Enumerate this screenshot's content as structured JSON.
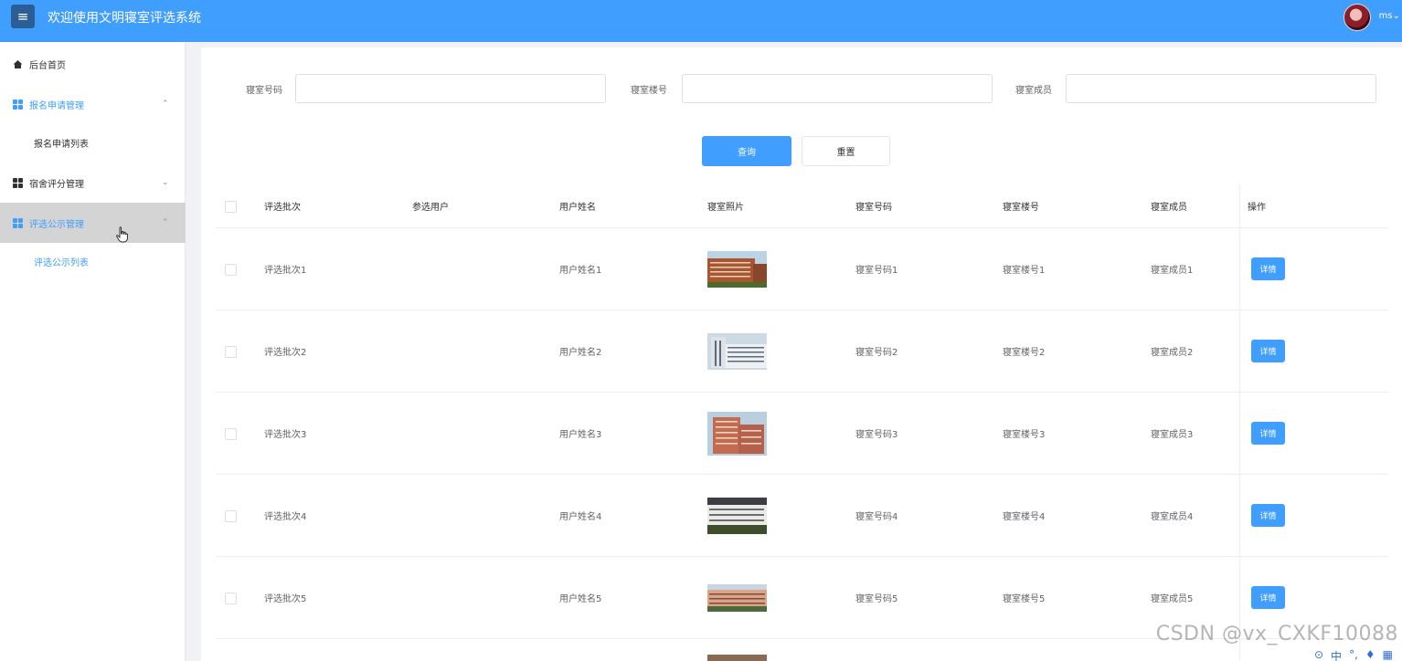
{
  "header": {
    "menu_icon": "hamburger-icon",
    "title": "欢迎使用文明寝室评选系统",
    "user": "ms",
    "user_chevron": "⌄"
  },
  "sidebar": {
    "items": [
      {
        "label": "后台首页",
        "icon": "home-icon"
      },
      {
        "label": "报名申请管理",
        "icon": "grid-icon",
        "chevron": "⌃",
        "expanded": true,
        "children": [
          {
            "label": "报名申请列表"
          }
        ]
      },
      {
        "label": "宿舍评分管理",
        "icon": "grid-icon",
        "chevron": "⌄",
        "expanded": false
      },
      {
        "label": "评选公示管理",
        "icon": "grid-icon",
        "chevron": "⌃",
        "expanded": true,
        "active": true,
        "children": [
          {
            "label": "评选公示列表",
            "active": true
          }
        ]
      }
    ]
  },
  "search": {
    "fields": [
      {
        "label": "寝室号码",
        "value": ""
      },
      {
        "label": "寝室楼号",
        "value": ""
      },
      {
        "label": "寝室成员",
        "value": ""
      }
    ],
    "query_label": "查询",
    "reset_label": "重置"
  },
  "table": {
    "columns": [
      "评选批次",
      "参选用户",
      "用户姓名",
      "寝室照片",
      "寝室号码",
      "寝室楼号",
      "寝室成员",
      "操作"
    ],
    "rows": [
      {
        "batch": "评选批次1",
        "candidate": "",
        "name": "用户姓名1",
        "room": "寝室号码1",
        "building": "寝室楼号1",
        "members": "寝室成员1",
        "action": "详情"
      },
      {
        "batch": "评选批次2",
        "candidate": "",
        "name": "用户姓名2",
        "room": "寝室号码2",
        "building": "寝室楼号2",
        "members": "寝室成员2",
        "action": "详情"
      },
      {
        "batch": "评选批次3",
        "candidate": "",
        "name": "用户姓名3",
        "room": "寝室号码3",
        "building": "寝室楼号3",
        "members": "寝室成员3",
        "action": "详情"
      },
      {
        "batch": "评选批次4",
        "candidate": "",
        "name": "用户姓名4",
        "room": "寝室号码4",
        "building": "寝室楼号4",
        "members": "寝室成员4",
        "action": "详情"
      },
      {
        "batch": "评选批次5",
        "candidate": "",
        "name": "用户姓名5",
        "room": "寝室号码5",
        "building": "寝室楼号5",
        "members": "寝室成员5",
        "action": "详情"
      }
    ]
  },
  "watermark": "CSDN @vx_CXKF10088",
  "ime_bar": [
    "中"
  ],
  "colors": {
    "primary": "#409eff",
    "sidebar_active": "#d4d4d4",
    "menu_btn": "#2c5d94"
  }
}
